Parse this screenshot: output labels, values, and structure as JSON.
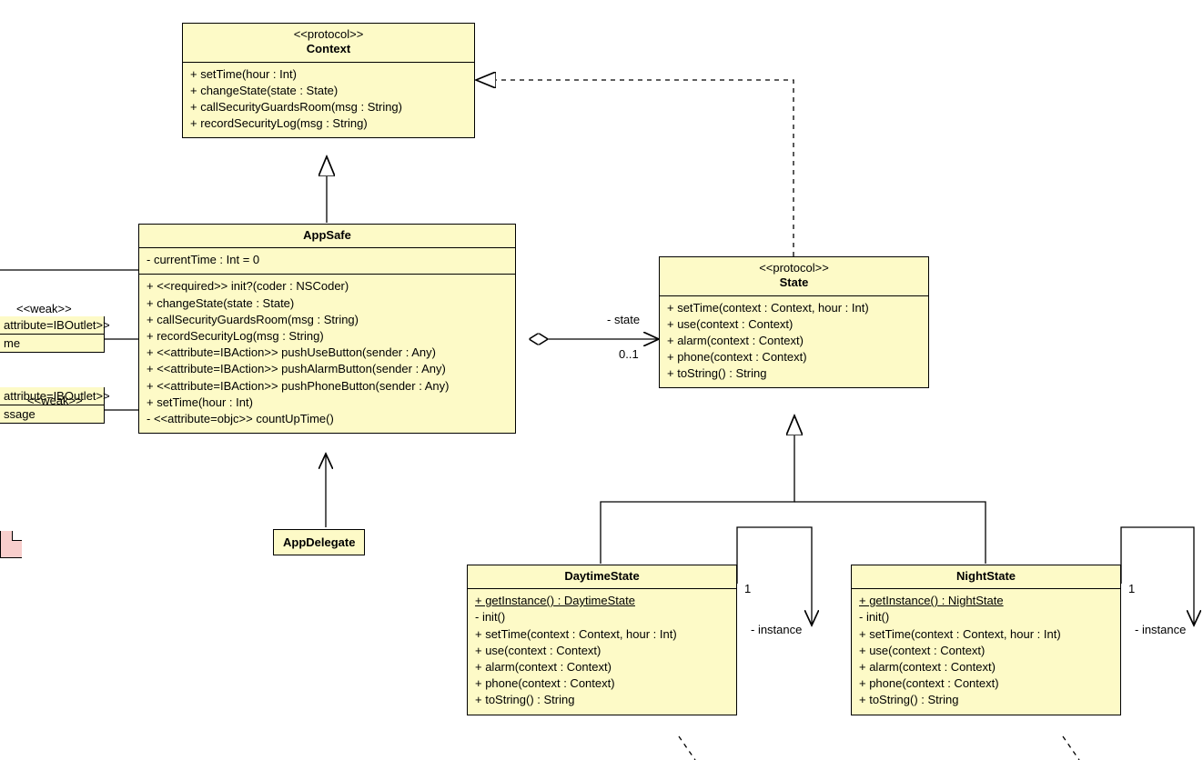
{
  "context": {
    "stereotype": "<<protocol>>",
    "name": "Context",
    "m1": "+ setTime(hour : Int)",
    "m2": "+ changeState(state : State)",
    "m3": "+ callSecurityGuardsRoom(msg : String)",
    "m4": "+ recordSecurityLog(msg : String)"
  },
  "appSafe": {
    "name": "AppSafe",
    "attr1": "- currentTime : Int = 0",
    "m1": "+ <<required>> init?(coder : NSCoder)",
    "m2": "+ changeState(state : State)",
    "m3": "+ callSecurityGuardsRoom(msg : String)",
    "m4": "+ recordSecurityLog(msg : String)",
    "m5": "+ <<attribute=IBAction>> pushUseButton(sender : Any)",
    "m6": "+ <<attribute=IBAction>> pushAlarmButton(sender : Any)",
    "m7": "+ <<attribute=IBAction>> pushPhoneButton(sender : Any)",
    "m8": "+ setTime(hour : Int)",
    "m9": "- <<attribute=objc>> countUpTime()"
  },
  "state": {
    "stereotype": "<<protocol>>",
    "name": "State",
    "m1": "+ setTime(context : Context, hour : Int)",
    "m2": "+ use(context : Context)",
    "m3": "+ alarm(context : Context)",
    "m4": "+ phone(context : Context)",
    "m5": "+ toString() : String"
  },
  "daytime": {
    "name": "DaytimeState",
    "m1": "+ getInstance() : DaytimeState",
    "m2": "- init()",
    "m3": "+ setTime(context : Context, hour : Int)",
    "m4": "+ use(context : Context)",
    "m5": "+ alarm(context : Context)",
    "m6": "+ phone(context : Context)",
    "m7": "+ toString() : String"
  },
  "night": {
    "name": "NightState",
    "m1": "+ getInstance() : NightState",
    "m2": "- init()",
    "m3": "+ setTime(context : Context, hour : Int)",
    "m4": "+ use(context : Context)",
    "m5": "+ alarm(context : Context)",
    "m6": "+ phone(context : Context)",
    "m7": "+ toString() : String"
  },
  "appDelegate": {
    "name": "AppDelegate"
  },
  "partialA": {
    "line1": "attribute=IBOutlet>>",
    "line2": "me"
  },
  "partialB": {
    "line1": "attribute=IBOutlet>>",
    "line2": "ssage"
  },
  "labels": {
    "weak": "<<weak>>",
    "stateRole": "- state",
    "stateMult": "0..1",
    "one": "1",
    "instance": "- instance"
  }
}
